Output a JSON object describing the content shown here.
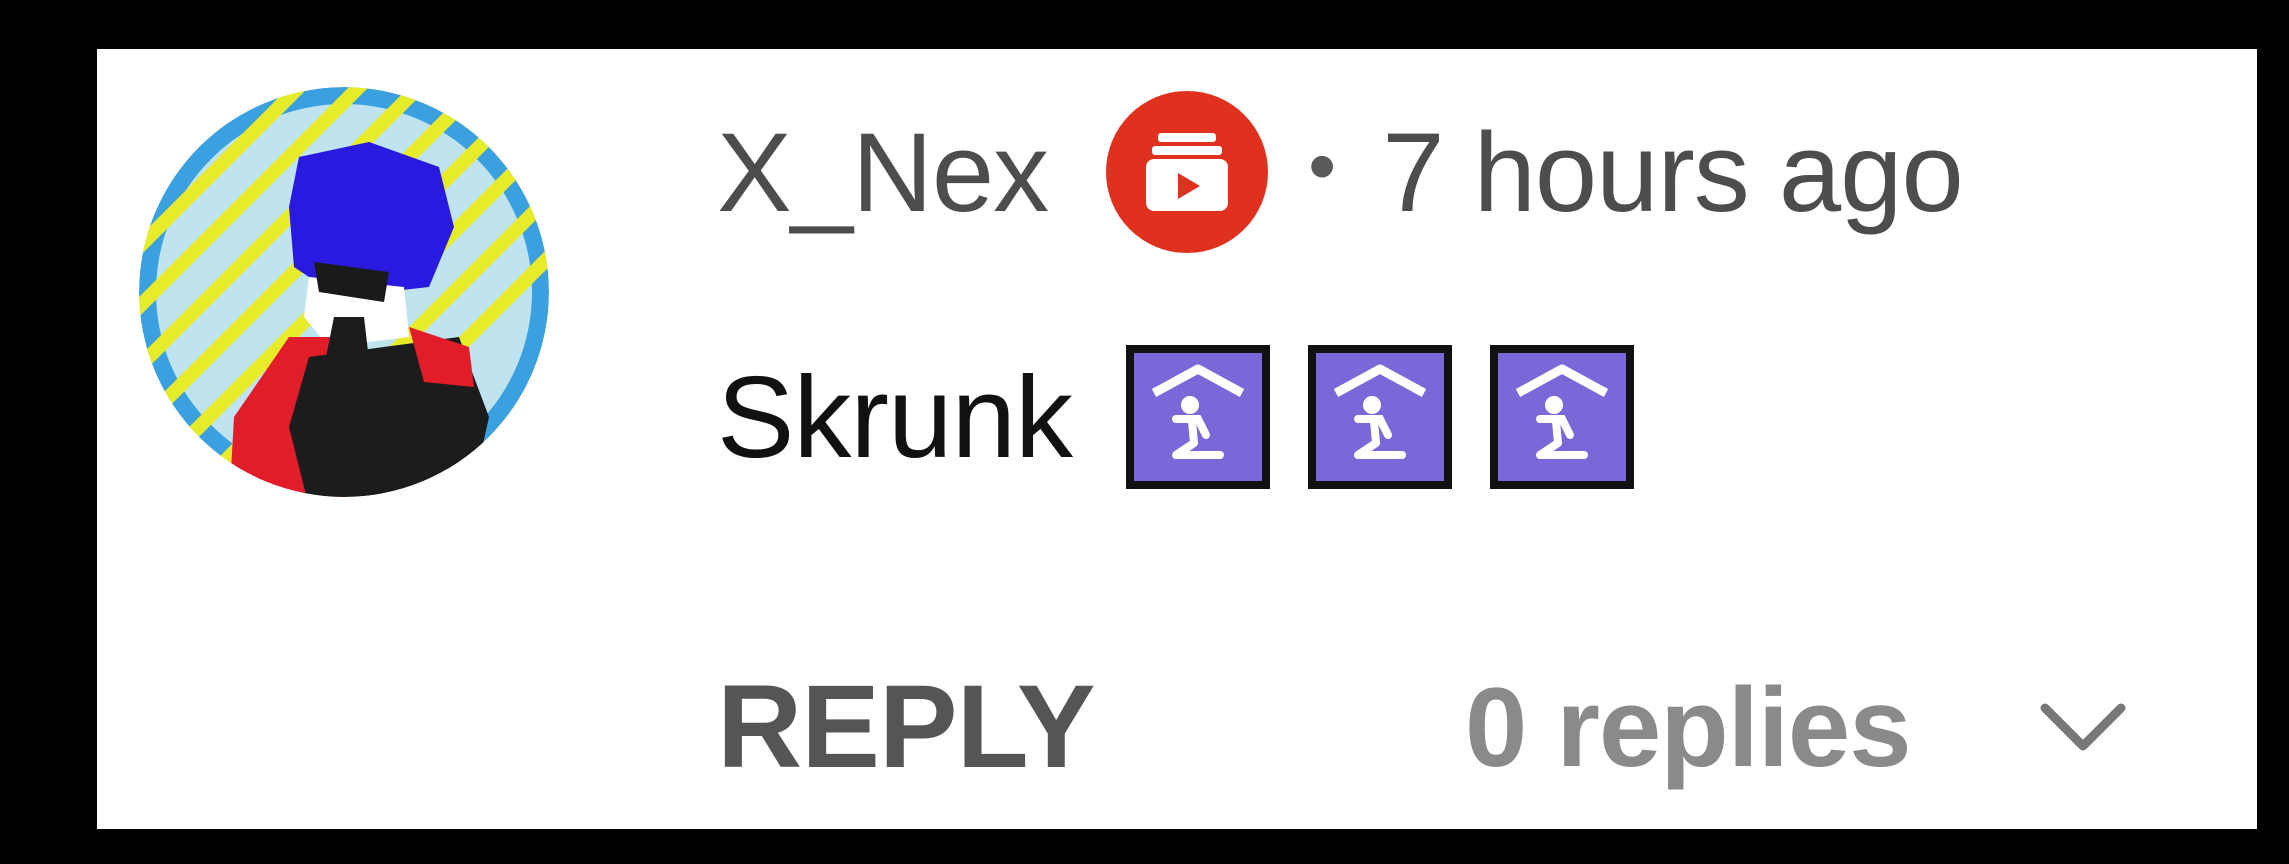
{
  "comment": {
    "author": "X_Nex",
    "author_badge_icon": "creator-badge-icon",
    "author_badge_color": "#e0301e",
    "separator": "•",
    "timestamp": "7 hours ago",
    "text": "Skrunk",
    "emotes": [
      {
        "icon": "praying-shelter-emote-icon",
        "color": "#7b68d8"
      },
      {
        "icon": "praying-shelter-emote-icon",
        "color": "#7b68d8"
      },
      {
        "icon": "praying-shelter-emote-icon",
        "color": "#7b68d8"
      }
    ],
    "reply_label": "REPLY",
    "replies_label": "0 replies",
    "expand_icon": "chevron-down-icon"
  },
  "colors": {
    "background": "#000000",
    "card": "#ffffff",
    "author_text": "#4d4d4d",
    "comment_text": "#111111",
    "reply_text": "#555555",
    "replies_text": "#8a8a8a"
  }
}
